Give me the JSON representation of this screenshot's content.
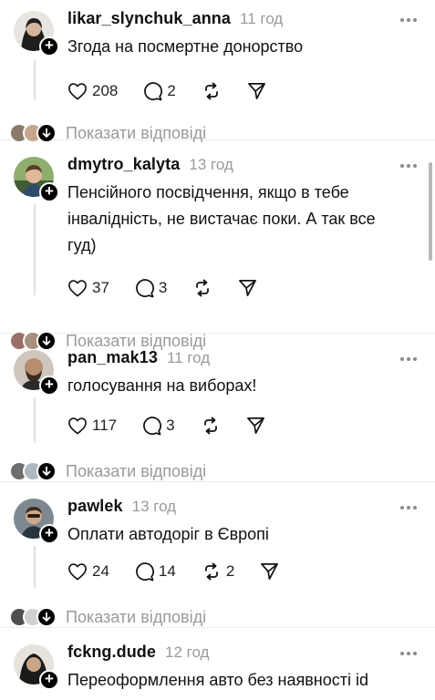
{
  "posts": [
    {
      "username": "likar_slynchuk_anna",
      "time": "11 год",
      "text": "Згода на посмертне донорство",
      "likes": "208",
      "comments": "2",
      "reposts": "",
      "show_replies": "Показати відповіді",
      "avatar_color": "#3a3a3a"
    },
    {
      "username": "dmytro_kalyta",
      "time": "13 год",
      "text": "Пенсійного посвідчення, якщо в тебе інвалідність, не вистачає поки. А так все гуд)",
      "likes": "37",
      "comments": "3",
      "reposts": "",
      "show_replies": "Показати відповіді",
      "avatar_color": "#5b7f4a"
    },
    {
      "username": "pan_mak13",
      "time": "11 год",
      "text": "голосування на виборах!",
      "likes": "117",
      "comments": "3",
      "reposts": "",
      "show_replies": "Показати відповіді",
      "avatar_color": "#6b5a4e"
    },
    {
      "username": "pawlek",
      "time": "13 год",
      "text": "Оплати автодоріг в Європі",
      "likes": "24",
      "comments": "14",
      "reposts": "2",
      "show_replies": "Показати відповіді",
      "avatar_color": "#4a5560"
    },
    {
      "username": "fckng.dude",
      "time": "12 год",
      "text": "Переоформлення авто без наявності id",
      "avatar_color": "#2b2b2b"
    }
  ],
  "icons": {
    "like": "heart-icon",
    "comment": "comment-bubble-icon",
    "repost": "repost-icon",
    "share": "send-icon",
    "more": "more-dots-icon",
    "follow": "plus-icon",
    "expand": "arrow-down-icon"
  }
}
